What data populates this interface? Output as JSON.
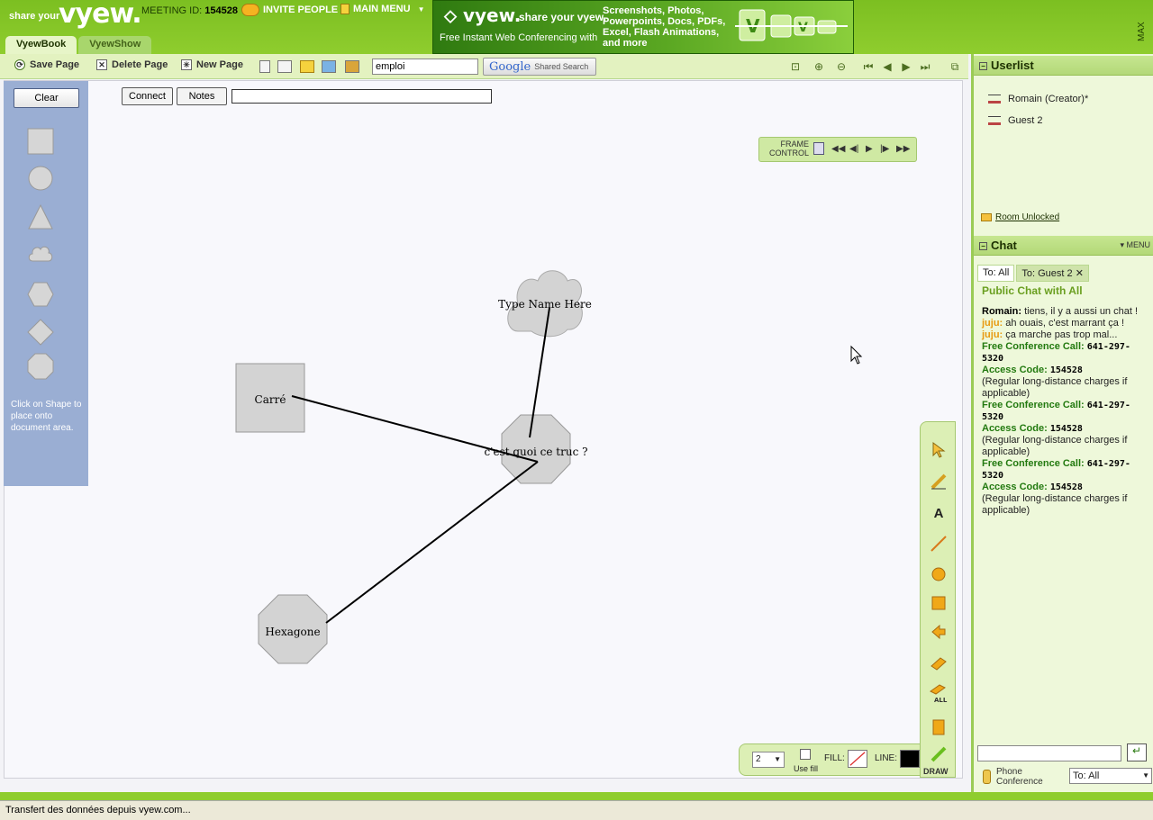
{
  "header": {
    "logo_small": "share your",
    "logo_big": "vyew.",
    "meeting_label": "MEETING ID:",
    "meeting_id": "154528",
    "invite_label": "INVITE PEOPLE",
    "main_menu_label": "MAIN MENU",
    "maximize_label": "MAX"
  },
  "banner": {
    "logo": "vyew.",
    "tagline": "share your vyew.",
    "subline": "Free Instant Web Conferencing with",
    "features": "Screenshots, Photos, Powerpoints, Docs, PDFs, Excel, Flash Animations, and more"
  },
  "tabs": [
    {
      "label": "VyewBook",
      "active": true
    },
    {
      "label": "VyewShow",
      "active": false
    }
  ],
  "toolbar": {
    "save_label": "Save Page",
    "delete_label": "Delete Page",
    "new_label": "New Page",
    "search_value": "emploi",
    "google_label": "Google",
    "shared_search_label": "Shared Search"
  },
  "shapes_panel": {
    "clear_label": "Clear",
    "hint": "Click on Shape to place onto document area.",
    "shapes": [
      "square",
      "circle",
      "triangle",
      "cloud",
      "hexagon",
      "diamond",
      "octagon"
    ]
  },
  "doc_toolbar": {
    "connect_label": "Connect",
    "notes_label": "Notes",
    "notes_value": ""
  },
  "frame_control": {
    "label": "FRAME CONTROL"
  },
  "canvas": {
    "nodes": [
      {
        "id": "cloud",
        "shape": "cloud",
        "label": "Type Name Here"
      },
      {
        "id": "square",
        "shape": "square",
        "label": "Carré"
      },
      {
        "id": "center",
        "shape": "octagon",
        "label": "c'est quoi ce truc ?"
      },
      {
        "id": "hex",
        "shape": "octagon",
        "label": "Hexagone"
      }
    ]
  },
  "draw_tools": {
    "draw_label": "DRAW",
    "size_value": "2",
    "use_fill_label": "Use fill",
    "fill_label": "FILL:",
    "line_label": "LINE:",
    "line_color": "#000000"
  },
  "userlist": {
    "title": "Userlist",
    "users": [
      {
        "name": "Romain (Creator)*"
      },
      {
        "name": "Guest 2"
      }
    ],
    "room_status": "Room Unlocked"
  },
  "chat": {
    "title": "Chat",
    "menu_label": "MENU",
    "tabs": [
      {
        "label": "To: All",
        "active": true
      },
      {
        "label": "To: Guest 2",
        "active": false
      }
    ],
    "heading": "Public Chat with All",
    "messages": [
      {
        "who": "Romain:",
        "text": "tiens, il y a aussi un chat !",
        "type": "romain"
      },
      {
        "who": "juju:",
        "text": "ah ouais, c'est marrant ça !",
        "type": "juju"
      },
      {
        "who": "juju:",
        "text": "ça marche pas trop mal...",
        "type": "juju"
      }
    ],
    "conference_blocks": [
      {
        "call_label": "Free Conference Call:",
        "call_number": "641-297-5320",
        "code_label": "Access Code:",
        "code": "154528",
        "note": "(Regular long-distance charges if applicable)"
      },
      {
        "call_label": "Free Conference Call:",
        "call_number": "641-297-5320",
        "code_label": "Access Code:",
        "code": "154528",
        "note": "(Regular long-distance charges if applicable)"
      },
      {
        "call_label": "Free Conference Call:",
        "call_number": "641-297-5320",
        "code_label": "Access Code:",
        "code": "154528",
        "note": "(Regular long-distance charges if applicable)"
      }
    ],
    "input_value": "",
    "phone_label": "Phone Conference",
    "to_value": "To: All"
  },
  "status": {
    "text": "Transfert des données depuis vyew.com..."
  },
  "colors": {
    "brand_green": "#8fcd2e",
    "panel_blue": "#9aaed3",
    "chat_green": "#237a10",
    "juju_orange": "#e89a10"
  }
}
